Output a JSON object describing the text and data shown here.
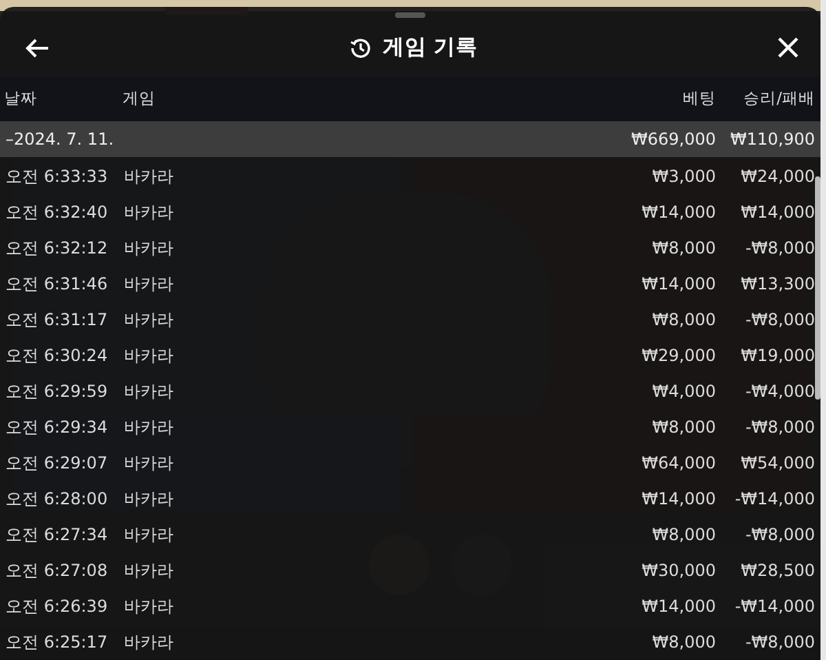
{
  "header": {
    "title": "게임 기록"
  },
  "table": {
    "columns": [
      "날짜",
      "게임",
      "베팅",
      "승리/패배"
    ],
    "summary": {
      "date": "–2024. 7. 11.",
      "bet": "₩669,000",
      "result": "₩110,900"
    },
    "rows": [
      {
        "time": "오전 6:33:33",
        "game": "바카라",
        "bet": "₩3,000",
        "result": "₩24,000"
      },
      {
        "time": "오전 6:32:40",
        "game": "바카라",
        "bet": "₩14,000",
        "result": "₩14,000"
      },
      {
        "time": "오전 6:32:12",
        "game": "바카라",
        "bet": "₩8,000",
        "result": "-₩8,000"
      },
      {
        "time": "오전 6:31:46",
        "game": "바카라",
        "bet": "₩14,000",
        "result": "₩13,300"
      },
      {
        "time": "오전 6:31:17",
        "game": "바카라",
        "bet": "₩8,000",
        "result": "-₩8,000"
      },
      {
        "time": "오전 6:30:24",
        "game": "바카라",
        "bet": "₩29,000",
        "result": "₩19,000"
      },
      {
        "time": "오전 6:29:59",
        "game": "바카라",
        "bet": "₩4,000",
        "result": "-₩4,000"
      },
      {
        "time": "오전 6:29:34",
        "game": "바카라",
        "bet": "₩8,000",
        "result": "-₩8,000"
      },
      {
        "time": "오전 6:29:07",
        "game": "바카라",
        "bet": "₩64,000",
        "result": "₩54,000"
      },
      {
        "time": "오전 6:28:00",
        "game": "바카라",
        "bet": "₩14,000",
        "result": "-₩14,000"
      },
      {
        "time": "오전 6:27:34",
        "game": "바카라",
        "bet": "₩8,000",
        "result": "-₩8,000"
      },
      {
        "time": "오전 6:27:08",
        "game": "바카라",
        "bet": "₩30,000",
        "result": "₩28,500"
      },
      {
        "time": "오전 6:26:39",
        "game": "바카라",
        "bet": "₩14,000",
        "result": "-₩14,000"
      },
      {
        "time": "오전 6:25:17",
        "game": "바카라",
        "bet": "₩8,000",
        "result": "-₩8,000"
      }
    ]
  }
}
